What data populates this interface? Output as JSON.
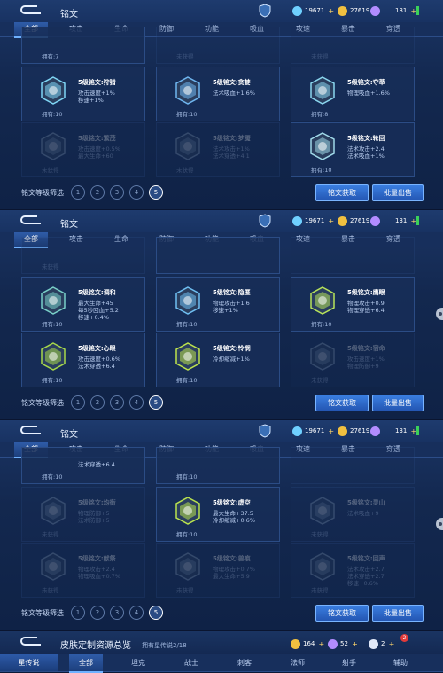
{
  "panels": [
    {
      "title": "铭文",
      "currency": {
        "diamond": "19671",
        "gold": "27619",
        "gem": "131"
      },
      "tabs": [
        "全部",
        "攻击",
        "生命",
        "防御",
        "功能",
        "吸血",
        "攻速",
        "暴击",
        "穿透"
      ],
      "rows": [
        [
          {
            "name": "",
            "s1": "",
            "s2": "",
            "s3": "",
            "own": "拥有:7",
            "dim": false,
            "partial": true
          },
          {
            "name": "",
            "s1": "",
            "s2": "",
            "s3": "",
            "own": "未获得",
            "dim": true,
            "partial": true
          },
          {
            "name": "",
            "s1": "",
            "s2": "",
            "s3": "",
            "own": "未获得",
            "dim": true,
            "partial": true
          }
        ],
        [
          {
            "name": "5级铭文:狩猎",
            "s1": "攻击速度+1%",
            "s2": "移速+1%",
            "s3": "",
            "own": "拥有:10",
            "dim": false,
            "color": "#7fd6f5"
          },
          {
            "name": "5级铭文:贪婪",
            "s1": "法术吸血+1.6%",
            "s2": "",
            "s3": "",
            "own": "拥有:10",
            "dim": false,
            "color": "#6fb6f0"
          },
          {
            "name": "5级铭文:夺萃",
            "s1": "物理吸血+1.6%",
            "s2": "",
            "s3": "",
            "own": "拥有:8",
            "dim": false,
            "color": "#8ad6ee"
          }
        ],
        [
          {
            "name": "5级铭文:繁茂",
            "s1": "攻击速度+0.5%",
            "s2": "最大生命+60",
            "s3": "",
            "own": "未获得",
            "dim": true,
            "color": "#8fa6c0"
          },
          {
            "name": "5级铭文:梦魇",
            "s1": "法术攻击+1%",
            "s2": "法术穿透+4.1",
            "s3": "",
            "own": "未获得",
            "dim": true,
            "color": "#8fa6c0"
          },
          {
            "name": "5级铭文:轮回",
            "s1": "法术攻击+2.4",
            "s2": "法术吸血+1%",
            "s3": "",
            "own": "拥有:10",
            "dim": false,
            "color": "#9fd8e8"
          }
        ]
      ],
      "filter_label": "铭文等级筛选",
      "levels": [
        "1",
        "2",
        "3",
        "4",
        "5"
      ],
      "btn_get": "铭文获取",
      "btn_sell": "批量出售"
    },
    {
      "title": "铭文",
      "currency": {
        "diamond": "19671",
        "gold": "27619",
        "gem": "131"
      },
      "tabs": [
        "全部",
        "攻击",
        "生命",
        "防御",
        "功能",
        "吸血",
        "攻速",
        "暴击",
        "穿透"
      ],
      "rows": [
        [
          {
            "name": "",
            "s1": "",
            "s2": "",
            "s3": "",
            "own": "未获得",
            "dim": true,
            "partial": true
          },
          {
            "name": "",
            "s1": "",
            "s2": "",
            "s3": "",
            "own": "",
            "dim": false,
            "partial": true
          },
          {
            "name": "",
            "s1": "",
            "s2": "",
            "s3": "",
            "own": "",
            "dim": true,
            "partial": true
          }
        ],
        [
          {
            "name": "5级铭文:调和",
            "s1": "最大生命+45",
            "s2": "每5秒回血+5.2",
            "s3": "移速+0.4%",
            "own": "拥有:10",
            "dim": false,
            "color": "#79d0c8"
          },
          {
            "name": "5级铭文:隐匿",
            "s1": "物理攻击+1.6",
            "s2": "移速+1%",
            "s3": "",
            "own": "拥有:10",
            "dim": false,
            "color": "#6fbff2"
          },
          {
            "name": "5级铭文:鹰眼",
            "s1": "物理攻击+0.9",
            "s2": "物理穿透+6.4",
            "s3": "",
            "own": "拥有:10",
            "dim": false,
            "color": "#b7e35a"
          }
        ],
        [
          {
            "name": "5级铭文:心眼",
            "s1": "攻击速度+0.6%",
            "s2": "法术穿透+6.4",
            "s3": "",
            "own": "拥有:10",
            "dim": false,
            "color": "#a7d94a"
          },
          {
            "name": "5级铭文:怜悯",
            "s1": "冷却缩减+1%",
            "s2": "",
            "s3": "",
            "own": "拥有:10",
            "dim": false,
            "color": "#bde34c"
          },
          {
            "name": "5级铭文:宿命",
            "s1": "攻击速度+1%",
            "s2": "物理防御+9",
            "s3": "",
            "own": "未获得",
            "dim": true,
            "color": "#8fa6c0"
          }
        ]
      ],
      "filter_label": "铭文等级筛选",
      "levels": [
        "1",
        "2",
        "3",
        "4",
        "5"
      ],
      "btn_get": "铭文获取",
      "btn_sell": "批量出售"
    },
    {
      "title": "铭文",
      "currency": {
        "diamond": "19671",
        "gold": "27619",
        "gem": "131"
      },
      "tabs": [
        "全部",
        "攻击",
        "生命",
        "防御",
        "功能",
        "吸血",
        "攻速",
        "暴击",
        "穿透"
      ],
      "rows": [
        [
          {
            "name": "",
            "s1": "法术穿透+6.4",
            "s2": "",
            "s3": "",
            "own": "拥有:10",
            "dim": false,
            "partial": true
          },
          {
            "name": "",
            "s1": "",
            "s2": "",
            "s3": "",
            "own": "拥有:10",
            "dim": false,
            "partial": true
          },
          {
            "name": "",
            "s1": "",
            "s2": "",
            "s3": "",
            "own": "",
            "dim": true,
            "partial": true
          }
        ],
        [
          {
            "name": "5级铭文:均衡",
            "s1": "物理防御+5",
            "s2": "法术防御+5",
            "s3": "",
            "own": "未获得",
            "dim": true,
            "color": "#8fa6c0"
          },
          {
            "name": "5级铭文:虚空",
            "s1": "最大生命+37.5",
            "s2": "冷却缩减+0.6%",
            "s3": "",
            "own": "拥有:10",
            "dim": false,
            "color": "#b9e34e"
          },
          {
            "name": "5级铭文:灵山",
            "s1": "法术吸血+9",
            "s2": "",
            "s3": "",
            "own": "未获得",
            "dim": true,
            "color": "#8fa6c0"
          }
        ],
        [
          {
            "name": "5级铭文:献祭",
            "s1": "物理攻击+2.4",
            "s2": "物理吸血+0.7%",
            "s3": "",
            "own": "未获得",
            "dim": true,
            "color": "#8fa6c0"
          },
          {
            "name": "5级铭文:兽痕",
            "s1": "物理攻击+0.7%",
            "s2": "最大生命+5.9",
            "s3": "",
            "own": "未获得",
            "dim": true,
            "color": "#8fa6c0"
          },
          {
            "name": "5级铭文:回声",
            "s1": "法术攻击+2.7",
            "s2": "法术穿透+2.7",
            "s3": "移速+0.6%",
            "own": "未获得",
            "dim": true,
            "color": "#8fa6c0"
          }
        ]
      ],
      "filter_label": "铭文等级筛选",
      "levels": [
        "1",
        "2",
        "3",
        "4",
        "5"
      ],
      "btn_get": "铭文获取",
      "btn_sell": "批量出售"
    }
  ],
  "strip": {
    "title": "皮肤定制资源总览",
    "sub": "拥有星传说2/18",
    "c1": "164",
    "c2": "52",
    "c3": "2",
    "badge": "2",
    "side_tab": "星传说",
    "tabs": [
      "全部",
      "坦克",
      "战士",
      "刺客",
      "法师",
      "射手",
      "辅助"
    ]
  },
  "colors": {
    "accent": "#3a7ee0",
    "panel": "#13284f"
  }
}
